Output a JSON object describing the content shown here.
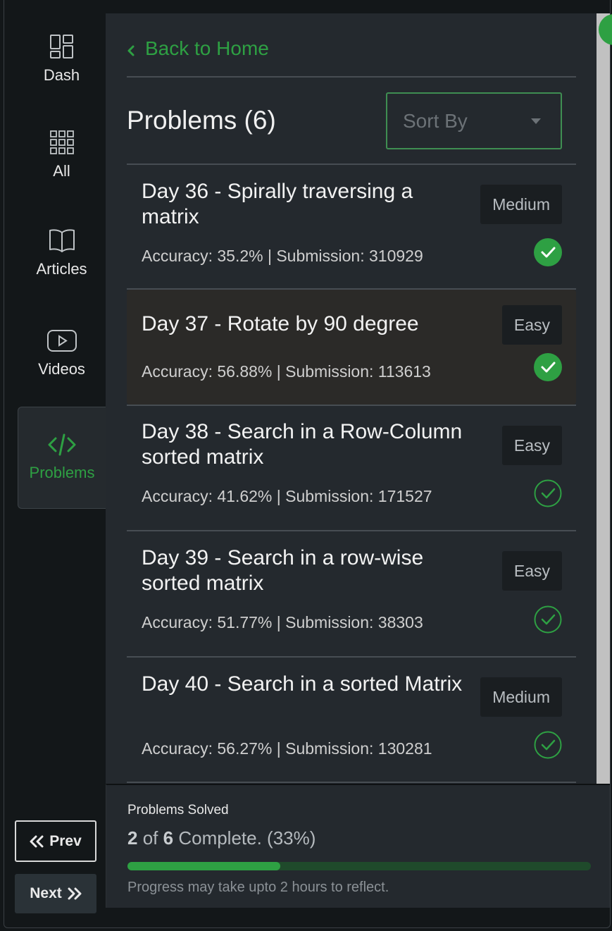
{
  "sidebar": {
    "items": [
      {
        "label": "Dash",
        "icon": "dashboard-icon"
      },
      {
        "label": "All",
        "icon": "grid-icon"
      },
      {
        "label": "Articles",
        "icon": "book-icon"
      },
      {
        "label": "Videos",
        "icon": "video-icon"
      },
      {
        "label": "Problems",
        "icon": "code-icon",
        "active": true
      }
    ],
    "prev_label": "Prev",
    "next_label": "Next"
  },
  "header": {
    "back_label": "Back to Home",
    "title": "Problems (6)",
    "sort_placeholder": "Sort By"
  },
  "problems": [
    {
      "title": "Day 36 - Spirally traversing a matrix",
      "meta": "Accuracy: 35.2% | Submission: 310929",
      "difficulty": "Medium",
      "solved": true
    },
    {
      "title": "Day 37 - Rotate by 90 degree",
      "meta": "Accuracy: 56.88% | Submission: 113613",
      "difficulty": "Easy",
      "solved": true
    },
    {
      "title": "Day 38 - Search in a Row-Column sorted matrix",
      "meta": "Accuracy: 41.62% | Submission: 171527",
      "difficulty": "Easy",
      "solved": false
    },
    {
      "title": "Day 39 - Search in a row-wise sorted matrix",
      "meta": "Accuracy: 51.77% | Submission: 38303",
      "difficulty": "Easy",
      "solved": false
    },
    {
      "title": "Day 40 - Search in a sorted Matrix",
      "meta": "Accuracy: 56.27% | Submission: 130281",
      "difficulty": "Medium",
      "solved": false
    }
  ],
  "progress": {
    "title": "Problems Solved",
    "solved": "2",
    "of_text": "of",
    "total": "6",
    "suffix": "Complete. (33%)",
    "fraction": 0.33,
    "note": "Progress may take upto 2 hours to reflect."
  },
  "colors": {
    "accent": "#2ea043",
    "panel": "#24292e",
    "background": "#131719"
  }
}
